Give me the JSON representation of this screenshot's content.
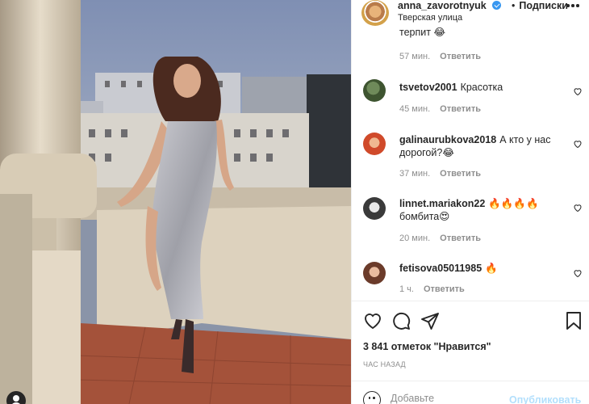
{
  "post": {
    "username": "anna_zavorotnyuk",
    "dot": "•",
    "follow_label": "Подписки",
    "location": "Тверская улица"
  },
  "comments": [
    {
      "user": "",
      "text": "терпит 😂",
      "time": "57 мин.",
      "reply": "Ответить"
    },
    {
      "user": "tsvetov2001",
      "text": "Красотка",
      "time": "45 мин.",
      "reply": "Ответить"
    },
    {
      "user": "galinaurubkova2018",
      "text": "А кто у нас дорогой?😂",
      "time": "37 мин.",
      "reply": "Ответить"
    },
    {
      "user": "linnet.mariakon22",
      "text": "🔥🔥🔥🔥 бомбита😍",
      "time": "20 мин.",
      "reply": "Ответить"
    },
    {
      "user": "fetisova05011985",
      "text": "🔥",
      "time": "1 ч.",
      "reply": "Ответить"
    }
  ],
  "likes_text": "3 841 отметок \"Нравится\"",
  "posted_text": "ЧАС НАЗАД",
  "comment_box": {
    "placeholder": "Добавьте",
    "publish_label": "Опубликовать"
  },
  "colors": {
    "accent": "#3897f0",
    "publish_disabled": "#b2dffc",
    "muted_text": "#8e8e8e",
    "divider": "#efefef"
  },
  "icons": [
    "verified-icon",
    "more-icon",
    "heart-icon",
    "comment-icon",
    "share-icon",
    "bookmark-icon",
    "emoji-icon",
    "user-tag-icon"
  ]
}
